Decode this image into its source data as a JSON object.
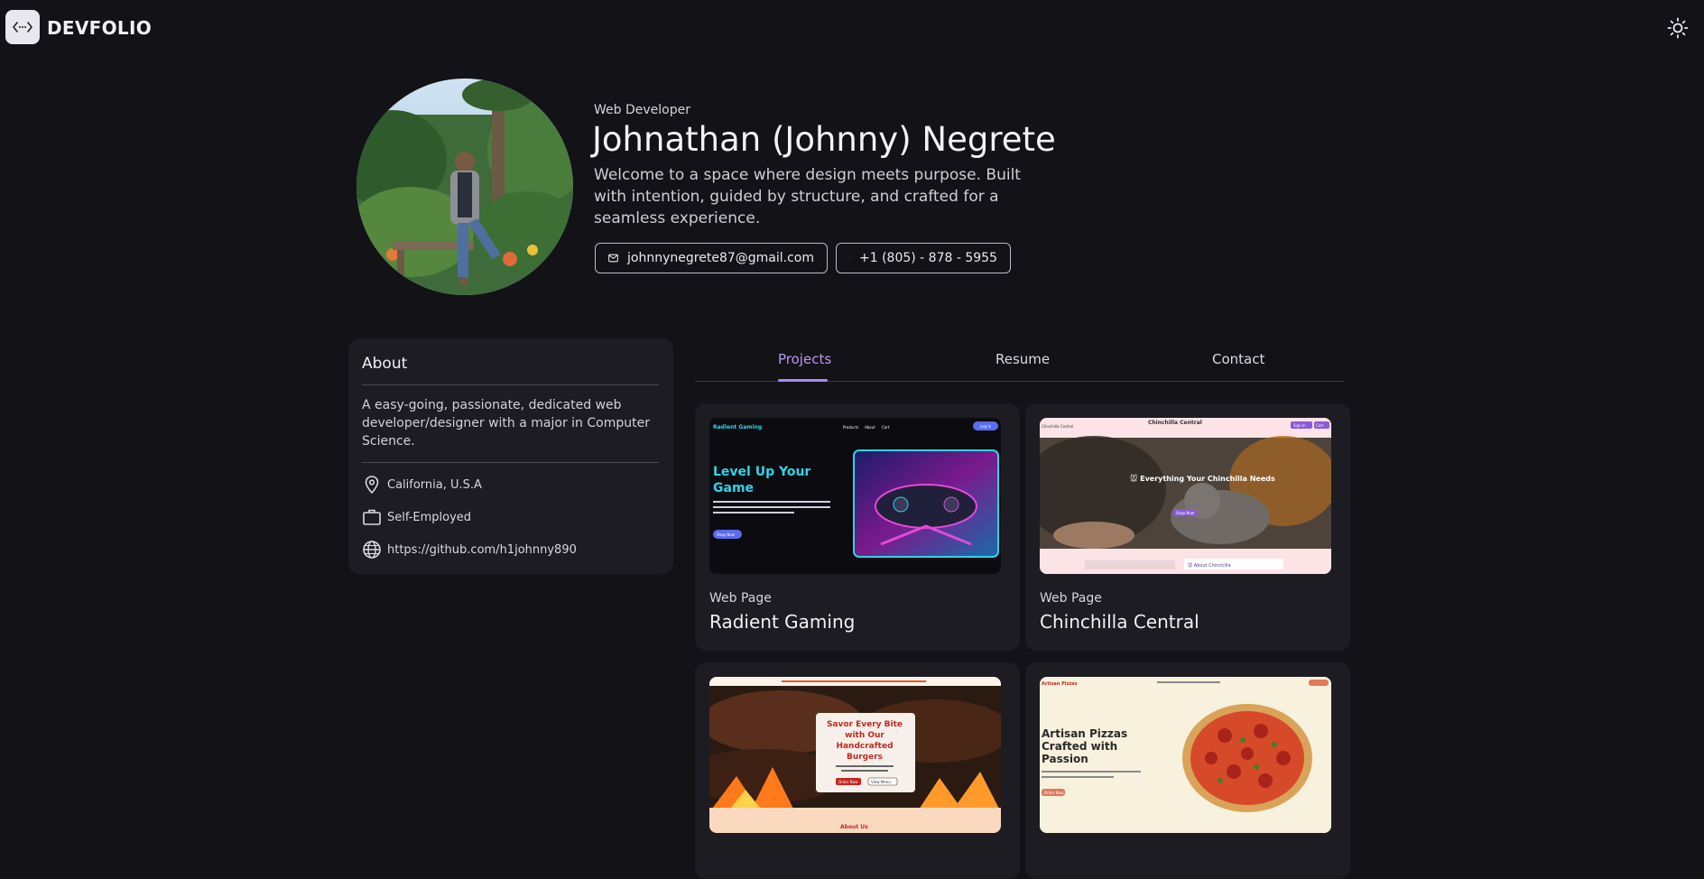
{
  "header": {
    "brand": "DEVFOLIO",
    "logo_icon": "code-brackets-icon",
    "theme_icon": "sun-icon"
  },
  "hero": {
    "role": "Web Developer",
    "name": "Johnathan (Johnny) Negrete",
    "intro": "Welcome to a space where design meets purpose. Built with intention, guided by structure, and crafted for a seamless experience.",
    "email": "johnnynegrete87@gmail.com",
    "phone": "+1 (805) - 878 - 5955"
  },
  "about": {
    "title": "About",
    "description": "A easy-going, passionate, dedicated web developer/designer with a major in Computer Science.",
    "location": "California, U.S.A",
    "employment": "Self-Employed",
    "website": "https://github.com/h1johnny890"
  },
  "tabs": [
    {
      "label": "Projects",
      "active": true
    },
    {
      "label": "Resume",
      "active": false
    },
    {
      "label": "Contact",
      "active": false
    }
  ],
  "projects": [
    {
      "type": "Web Page",
      "title": "Radient Gaming",
      "thumb": {
        "brand": "Radient Gaming",
        "nav": [
          "Products",
          "About",
          "Cart"
        ],
        "cta": "Log In",
        "headline": "Level Up Your Game",
        "button": "Shop Now"
      }
    },
    {
      "type": "Web Page",
      "title": "Chinchilla Central",
      "thumb": {
        "brand": "Chinchilla Central",
        "left_brand": "Chinchilla Central",
        "buttons": [
          "Sign In",
          "Cart"
        ],
        "headline": "🐭 Everything Your Chinchilla Needs",
        "button": "Shop Now",
        "footer": "🐭 About Chinchilla"
      }
    },
    {
      "type": "",
      "title": "",
      "thumb": {
        "headline": "Savor Every Bite with Our Handcrafted Burgers",
        "buttons": [
          "Order Now",
          "View Menu"
        ],
        "footer": "About Us"
      }
    },
    {
      "type": "",
      "title": "",
      "thumb": {
        "brand": "Artisan Pizzas",
        "headline": "Artisan Pizzas Crafted with Passion",
        "button": "Order Now"
      }
    }
  ],
  "colors": {
    "background": "#131217",
    "card": "#1d1c22",
    "accent": "#a98bf0"
  }
}
